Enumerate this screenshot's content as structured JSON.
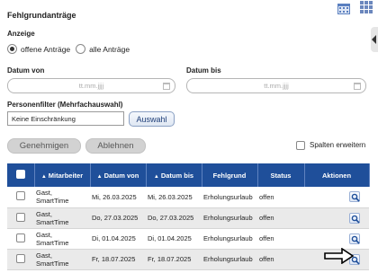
{
  "page": {
    "title": "Fehlgrundanträge"
  },
  "top_icons": [
    "calendar-icon",
    "grid-icon"
  ],
  "anzeige": {
    "label": "Anzeige",
    "options": [
      {
        "label": "offene Anträge",
        "selected": true
      },
      {
        "label": "alle Anträge",
        "selected": false
      }
    ]
  },
  "datum_von": {
    "label": "Datum von",
    "placeholder": "tt.mm.jjjj"
  },
  "datum_bis": {
    "label": "Datum bis",
    "placeholder": "tt.mm.jjjj"
  },
  "personenfilter": {
    "label": "Personenfilter (Mehrfachauswahl)",
    "value": "Keine Einschränkung",
    "button": "Auswahl"
  },
  "actions": {
    "approve": "Genehmigen",
    "reject": "Ablehnen",
    "expand_columns": "Spalten erweitern"
  },
  "table": {
    "headers": [
      "",
      "Mitarbeiter",
      "Datum von",
      "Datum bis",
      "Fehlgrund",
      "Status",
      "Aktionen"
    ],
    "rows": [
      {
        "employee_1": "Gast,",
        "employee_2": "SmartTime",
        "from": "Mi, 26.03.2025",
        "to": "Mi, 26.03.2025",
        "reason": "Erholungsurlaub",
        "status": "offen"
      },
      {
        "employee_1": "Gast,",
        "employee_2": "SmartTime",
        "from": "Do, 27.03.2025",
        "to": "Do, 27.03.2025",
        "reason": "Erholungsurlaub",
        "status": "offen"
      },
      {
        "employee_1": "Gast,",
        "employee_2": "SmartTime",
        "from": "Di, 01.04.2025",
        "to": "Di, 01.04.2025",
        "reason": "Erholungsurlaub",
        "status": "offen"
      },
      {
        "employee_1": "Gast,",
        "employee_2": "SmartTime",
        "from": "Fr, 18.07.2025",
        "to": "Fr, 18.07.2025",
        "reason": "Erholungsurlaub",
        "status": "offen"
      }
    ]
  },
  "colors": {
    "header_blue": "#1f4f9a",
    "button_gray": "#d2d2d2",
    "accent_text": "#1e3e78"
  }
}
